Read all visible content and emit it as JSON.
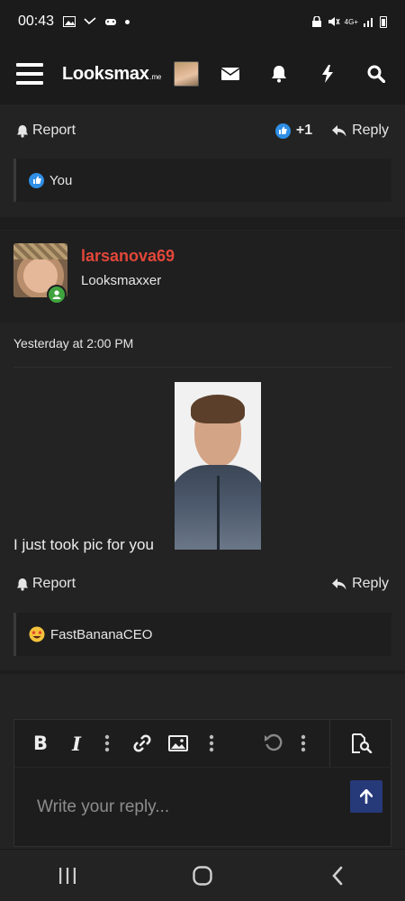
{
  "status_bar": {
    "time": "00:43",
    "network": "4G+"
  },
  "header": {
    "logo_main": "Looksmax",
    "logo_suffix": ".me",
    "icons": [
      "menu-icon",
      "envelope-icon",
      "bell-icon",
      "lightning-icon",
      "search-icon"
    ]
  },
  "post1": {
    "report_label": "Report",
    "like_count": "+1",
    "reply_label": "Reply",
    "reaction_user": "You"
  },
  "post2": {
    "username": "larsanova69",
    "user_title": "Looksmaxxer",
    "date": "Yesterday at 2:00 PM",
    "text": "I just took pic for you",
    "report_label": "Report",
    "reply_label": "Reply",
    "reaction_user": "FastBananaCEO"
  },
  "composer": {
    "placeholder": "Write your reply...",
    "tool_bold": "B",
    "tool_italic": "I"
  },
  "colors": {
    "username": "#e2473a",
    "like_blue": "#2f8fe6",
    "online_green": "#3fa33f",
    "send_button": "#263a7a"
  }
}
